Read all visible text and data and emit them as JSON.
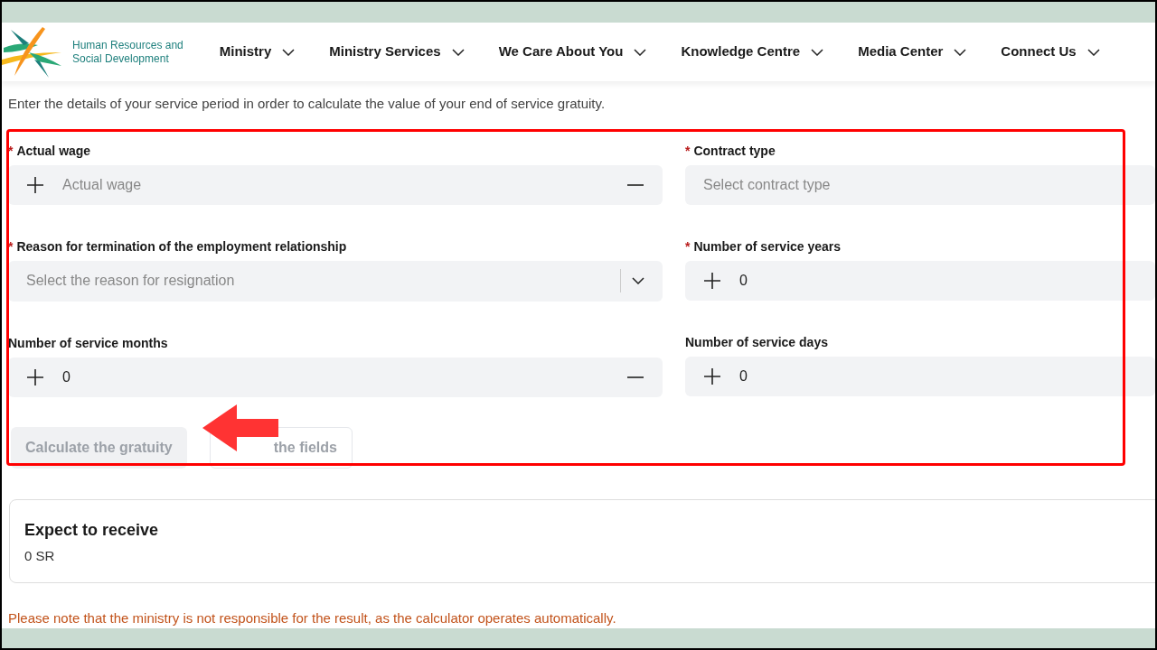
{
  "header": {
    "logo_text": [
      "Human Resources and",
      "Social Development"
    ],
    "nav": [
      {
        "label": "Ministry"
      },
      {
        "label": "Ministry Services"
      },
      {
        "label": "We Care About You"
      },
      {
        "label": "Knowledge Centre"
      },
      {
        "label": "Media Center"
      },
      {
        "label": "Connect Us"
      }
    ]
  },
  "intro": "Enter the details of your service period in order to calculate the value of your end of service gratuity.",
  "fields": [
    {
      "label": "Actual wage",
      "marker": "*",
      "kind": "stepper",
      "placeholder": "Actual wage",
      "minus": true
    },
    {
      "label": "Contract type",
      "marker": "*",
      "kind": "select",
      "placeholder": "Select contract type"
    },
    {
      "label": "Reason for termination of the employment relationship",
      "marker": "*",
      "kind": "dropdown",
      "placeholder": "Select the reason for resignation"
    },
    {
      "label": "Number of service years",
      "marker": "*",
      "kind": "stepper",
      "value": "0",
      "minus": false
    },
    {
      "label": "Number of service months",
      "kind": "stepper",
      "value": "0",
      "minus": true
    },
    {
      "label": "Number of service days",
      "kind": "stepper",
      "value": "0",
      "minus": false
    }
  ],
  "buttons": [
    {
      "label": "Calculate the gratuity",
      "disabled": true,
      "kind": "filled"
    },
    {
      "label": "the fields",
      "disabled": true,
      "kind": "outline"
    }
  ],
  "result": {
    "title": "Expect to receive",
    "value": "0 SR"
  },
  "note": "Please note that the ministry is not responsible for the result, as the calculator operates automatically."
}
